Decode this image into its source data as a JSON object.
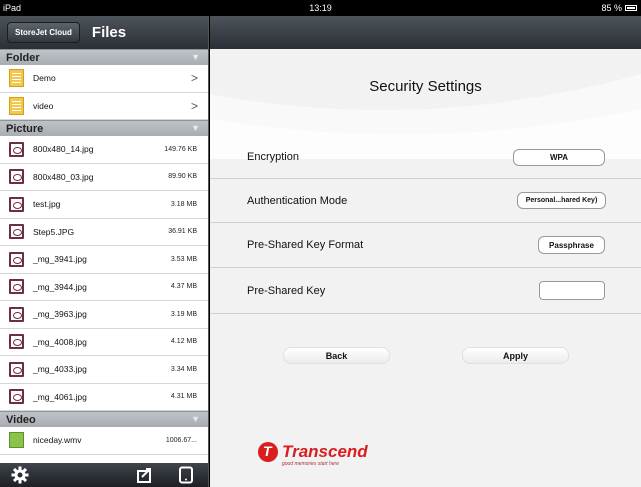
{
  "status_bar": {
    "device": "iPad",
    "time": "13:19",
    "battery": "85 %"
  },
  "sidebar": {
    "storejet_label": "StoreJet Cloud",
    "title": "Files",
    "sections": [
      {
        "title": "Folder",
        "items": [
          {
            "name": "Demo"
          },
          {
            "name": "video"
          }
        ]
      },
      {
        "title": "Picture",
        "items": [
          {
            "name": "800x480_14.jpg",
            "size": "149.76 KB"
          },
          {
            "name": "800x480_03.jpg",
            "size": "89.90 KB"
          },
          {
            "name": "test.jpg",
            "size": "3.18 MB"
          },
          {
            "name": "Step5.JPG",
            "size": "36.91 KB"
          },
          {
            "name": "_mg_3941.jpg",
            "size": "3.53 MB"
          },
          {
            "name": "_mg_3944.jpg",
            "size": "4.37 MB"
          },
          {
            "name": "_mg_3963.jpg",
            "size": "3.19 MB"
          },
          {
            "name": "_mg_4008.jpg",
            "size": "4.12 MB"
          },
          {
            "name": "_mg_4033.jpg",
            "size": "3.34 MB"
          },
          {
            "name": "_mg_4061.jpg",
            "size": "4.31 MB"
          }
        ]
      },
      {
        "title": "Video",
        "items": [
          {
            "name": "niceday.wmv",
            "size": "1006.67..."
          }
        ]
      }
    ],
    "footer_icons": [
      "gear-icon",
      "upload-icon",
      "device-icon"
    ]
  },
  "main": {
    "title": "Security Settings",
    "settings": [
      {
        "label": "Encryption",
        "value": "WPA"
      },
      {
        "label": "Authentication Mode",
        "value": "Personal...hared Key)"
      },
      {
        "label": "Pre-Shared Key Format",
        "value": "Passphrase"
      },
      {
        "label": "Pre-Shared Key",
        "value": ""
      }
    ],
    "back_label": "Back",
    "apply_label": "Apply",
    "logo_text": "Transcend",
    "logo_tagline": "good memories start here"
  },
  "colors": {
    "brand_red": "#d81e1e",
    "header_dark": "#2b2f35",
    "section_gray": "#b4b8bd"
  }
}
